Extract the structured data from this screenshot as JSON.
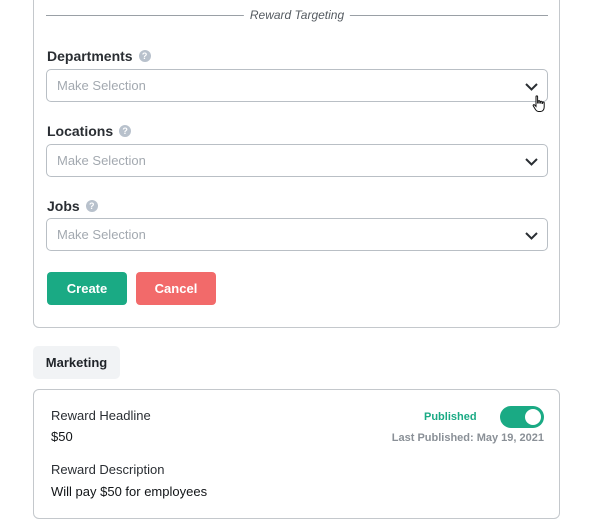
{
  "targeting": {
    "section_title": "Reward Targeting",
    "fields": [
      {
        "label": "Departments",
        "help": "?",
        "placeholder": "Make Selection"
      },
      {
        "label": "Locations",
        "help": "?",
        "placeholder": "Make Selection"
      },
      {
        "label": "Jobs",
        "help": "?",
        "placeholder": "Make Selection"
      }
    ],
    "create_label": "Create",
    "cancel_label": "Cancel"
  },
  "marketing": {
    "tab_label": "Marketing",
    "headline_label": "Reward Headline",
    "headline_value": "$50",
    "status": "Published",
    "published_toggle_on": true,
    "last_published": "Last Published: May 19, 2021",
    "description_label": "Reward Description",
    "description_value": "Will pay $50 for employees"
  },
  "colors": {
    "accent_green": "#1aaa84",
    "cancel_red": "#f26a6a"
  }
}
